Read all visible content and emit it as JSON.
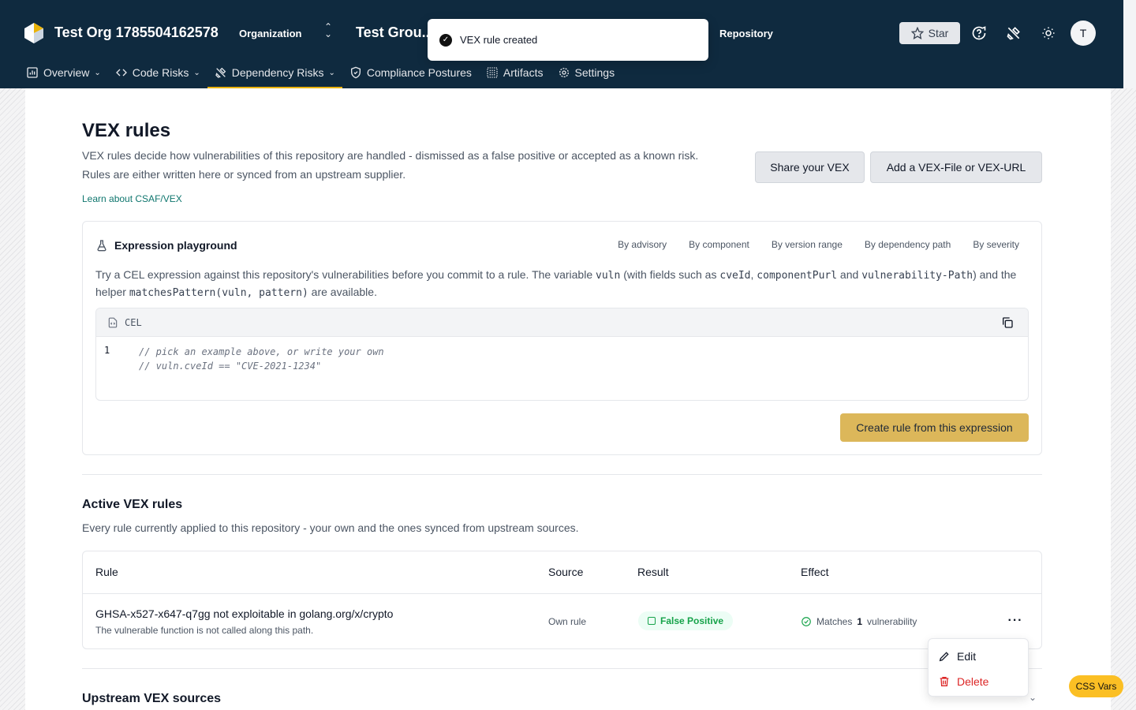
{
  "header": {
    "org_title": "Test Org 1785504162578",
    "org_label": "Organization",
    "group_title": "Test Grou..",
    "repo_label": "Repository",
    "star_label": "Star",
    "avatar_letter": "T",
    "accent_color": "#eab308"
  },
  "toast": {
    "message": "VEX rule created"
  },
  "nav": [
    {
      "label": "Overview",
      "dropdown": true,
      "icon": "chart-icon"
    },
    {
      "label": "Code Risks",
      "dropdown": true,
      "icon": "code-icon"
    },
    {
      "label": "Dependency Risks",
      "dropdown": true,
      "icon": "tools-icon",
      "active": true
    },
    {
      "label": "Compliance Postures",
      "dropdown": false,
      "icon": "shield-icon"
    },
    {
      "label": "Artifacts",
      "dropdown": false,
      "icon": "list-icon"
    },
    {
      "label": "Settings",
      "dropdown": false,
      "icon": "gear-icon"
    }
  ],
  "page": {
    "title": "VEX rules",
    "description": "VEX rules decide how vulnerabilities of this repository are handled - dismissed as a false positive or accepted as a known risk. Rules are either written here or synced from an upstream supplier.",
    "learn_link": "Learn about CSAF/VEX",
    "share_button": "Share your VEX",
    "add_button": "Add a VEX-File or VEX-URL"
  },
  "playground": {
    "title": "Expression playground",
    "tabs": [
      "By advisory",
      "By component",
      "By version range",
      "By dependency path",
      "By severity"
    ],
    "desc_1": "Try a CEL expression against this repository's vulnerabilities before you commit to a rule. The variable ",
    "code_vuln": "vuln",
    "desc_2": " (with fields such as ",
    "code_cveid": "cveId",
    "desc_3": ", ",
    "code_purl": "componentPurl",
    "desc_4": " and ",
    "code_path": "vulnerability-Path",
    "desc_5": ") and the helper ",
    "code_helper": "matchesPattern(vuln, pattern)",
    "desc_6": " are available.",
    "editor_lang": "CEL",
    "line_number": "1",
    "code_line_1": "// pick an example above, or write your own",
    "code_line_2": "// vuln.cveId == \"CVE-2021-1234\"",
    "create_button": "Create rule from this expression"
  },
  "active_rules": {
    "title": "Active VEX rules",
    "description": "Every rule currently applied to this repository - your own and the ones synced from upstream sources.",
    "columns": [
      "Rule",
      "Source",
      "Result",
      "Effect"
    ],
    "rows": [
      {
        "name": "GHSA-x527-x647-q7gg not exploitable in golang.org/x/crypto",
        "subtitle": "The vulnerable function is not called along this path.",
        "source": "Own rule",
        "result": "False Positive",
        "effect_prefix": "Matches",
        "effect_count": "1",
        "effect_suffix": "vulnerability"
      }
    ]
  },
  "row_menu": {
    "edit": "Edit",
    "delete": "Delete"
  },
  "upstream": {
    "title": "Upstream VEX sources"
  },
  "css_vars_badge": "CSS Vars"
}
